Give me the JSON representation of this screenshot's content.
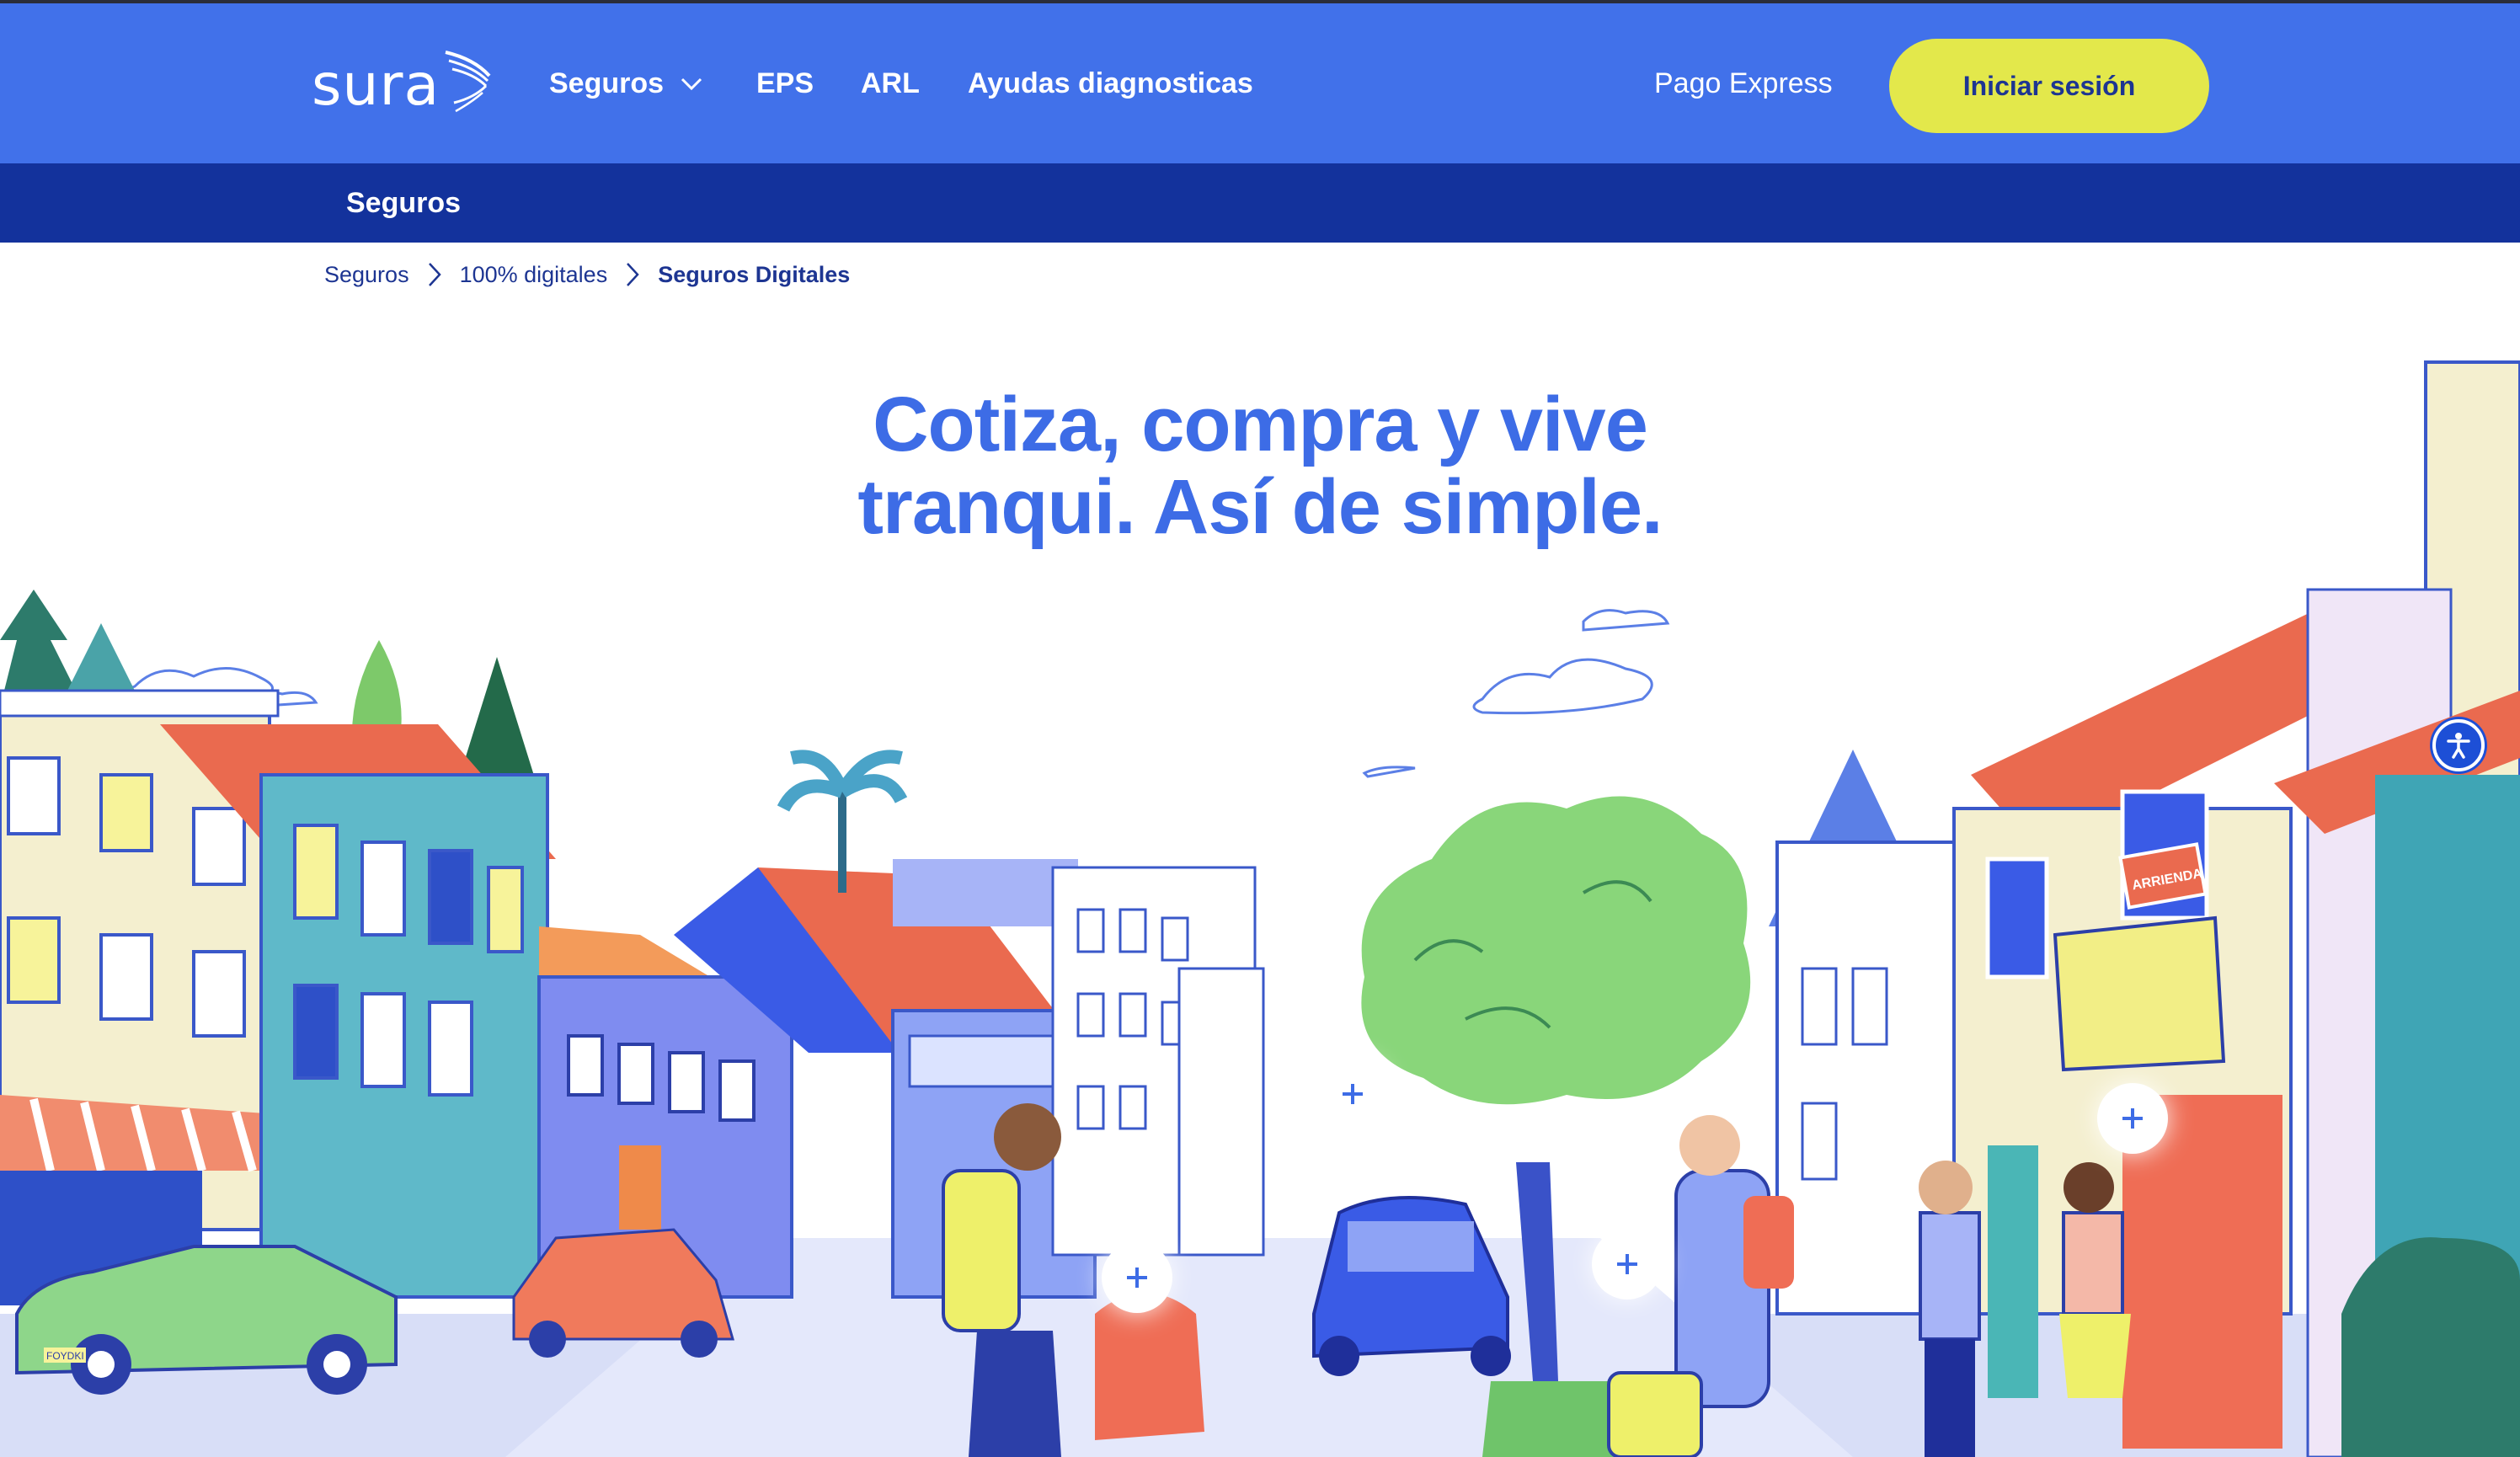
{
  "nav": {
    "logo_text": "sura",
    "items": [
      {
        "label": "Seguros",
        "has_dropdown": true
      },
      {
        "label": "EPS"
      },
      {
        "label": "ARL"
      },
      {
        "label": "Ayudas diagnosticas"
      }
    ],
    "pago_express": "Pago Express",
    "login_button": "Iniciar sesión"
  },
  "subnav": {
    "title": "Seguros"
  },
  "breadcrumb": [
    {
      "label": "Seguros"
    },
    {
      "label": "100% digitales"
    },
    {
      "label": "Seguros Digitales"
    }
  ],
  "hero": {
    "headline_line1": "Cotiza, compra y vive",
    "headline_line2": "tranqui. Así de simple."
  },
  "illustration": {
    "sign_text": "ARRIENDA",
    "plate_text": "FOYDKI"
  },
  "colors": {
    "nav_bg": "#4171ea",
    "subnav_bg": "#13329c",
    "login_bg": "#e3e84b",
    "headline": "#3d6ce6",
    "breadcrumb": "#1d3592"
  },
  "icons": [
    "sura-logo-icon",
    "chevron-down-icon",
    "chevron-right-icon",
    "plus-icon",
    "accessibility-icon"
  ]
}
